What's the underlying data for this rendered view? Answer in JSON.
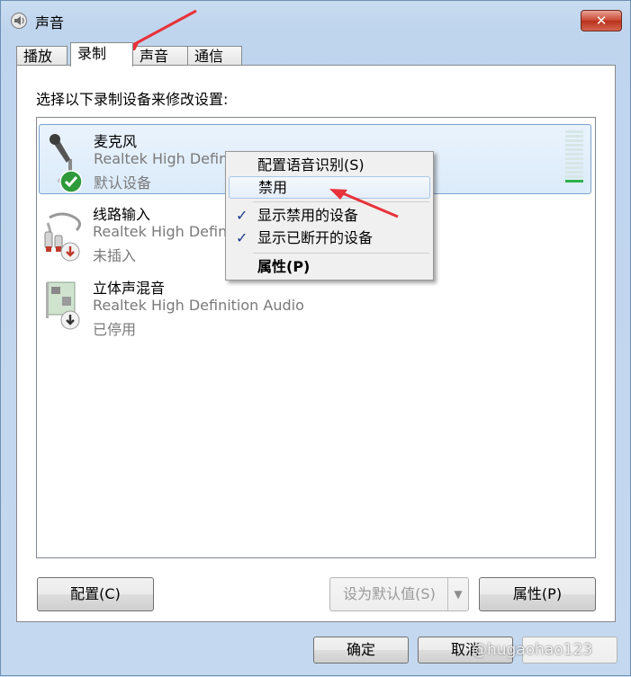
{
  "window": {
    "title": "声音",
    "close": "✕"
  },
  "tabs": [
    {
      "label": "播放"
    },
    {
      "label": "录制"
    },
    {
      "label": "声音"
    },
    {
      "label": "通信"
    }
  ],
  "instruction": "选择以下录制设备来修改设置:",
  "devices": [
    {
      "name": "麦克风",
      "desc": "Realtek High Definition Audio",
      "status": "默认设备",
      "icon": "microphone-icon"
    },
    {
      "name": "线路输入",
      "desc": "Realtek High Definition Audio",
      "status": "未插入",
      "icon": "line-in-cable-icon"
    },
    {
      "name": "立体声混音",
      "desc": "Realtek High Definition Audio",
      "status": "已停用",
      "icon": "sound-card-icon"
    }
  ],
  "context_menu": {
    "items": [
      {
        "label": "配置语音识别(S)"
      },
      {
        "label": "禁用"
      },
      {
        "label": "显示禁用的设备",
        "checked": true
      },
      {
        "label": "显示已断开的设备",
        "checked": true
      },
      {
        "label": "属性(P)"
      }
    ]
  },
  "buttons": {
    "configure": "配置(C)",
    "set_default": "设为默认值(S)",
    "properties": "属性(P)",
    "ok": "确定",
    "cancel": "取消"
  },
  "watermark": "@hugaohao123",
  "colors": {
    "accent_arrow": "#e8323a",
    "selection": "#dbebfa",
    "meter_active": "#2fb24c"
  }
}
